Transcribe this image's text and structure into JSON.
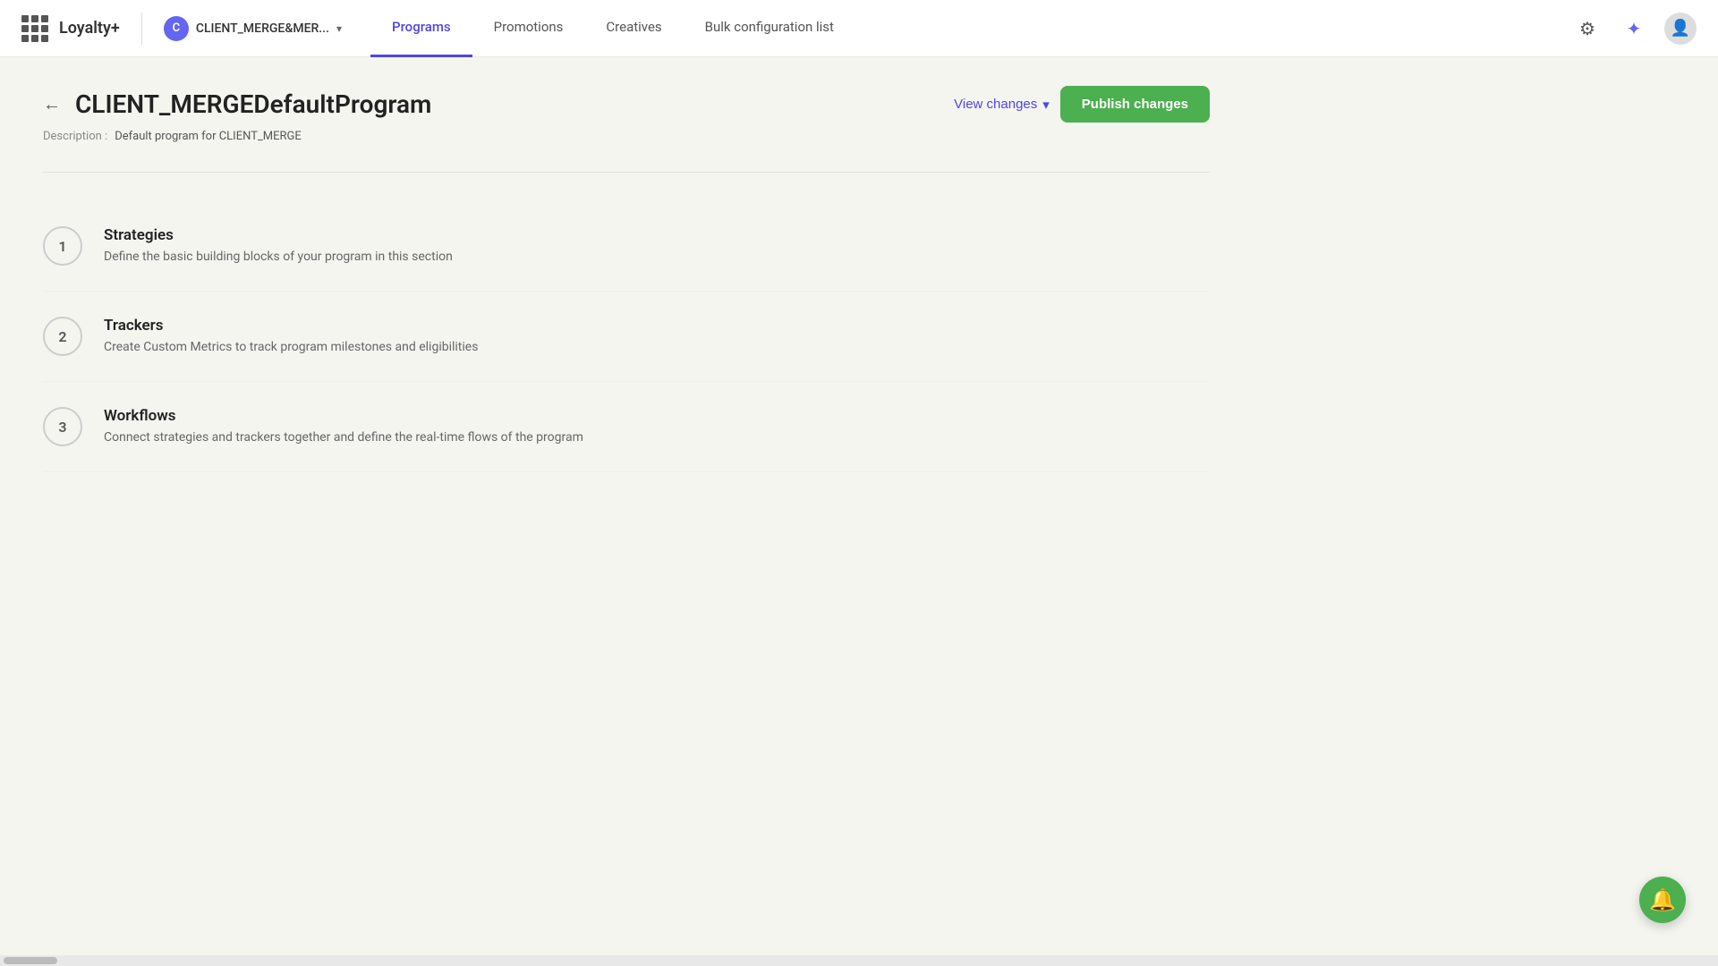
{
  "app": {
    "title": "Loyalty+",
    "client": {
      "initial": "C",
      "name": "CLIENT_MERGE&MER..."
    }
  },
  "nav": {
    "links": [
      {
        "id": "programs",
        "label": "Programs",
        "active": true
      },
      {
        "id": "promotions",
        "label": "Promotions",
        "active": false
      },
      {
        "id": "creatives",
        "label": "Creatives",
        "active": false
      },
      {
        "id": "bulk-config",
        "label": "Bulk configuration list",
        "active": false
      }
    ]
  },
  "page": {
    "title": "CLIENT_MERGEDefaultProgram",
    "description_label": "Description :",
    "description_value": "Default program for CLIENT_MERGE",
    "view_changes_label": "View changes",
    "publish_label": "Publish changes"
  },
  "sections": [
    {
      "number": "1",
      "title": "Strategies",
      "description": "Define the basic building blocks of your program in this section"
    },
    {
      "number": "2",
      "title": "Trackers",
      "description": "Create Custom Metrics to track program milestones and eligibilities"
    },
    {
      "number": "3",
      "title": "Workflows",
      "description": "Connect strategies and trackers together and define the real-time flows of the program"
    }
  ]
}
